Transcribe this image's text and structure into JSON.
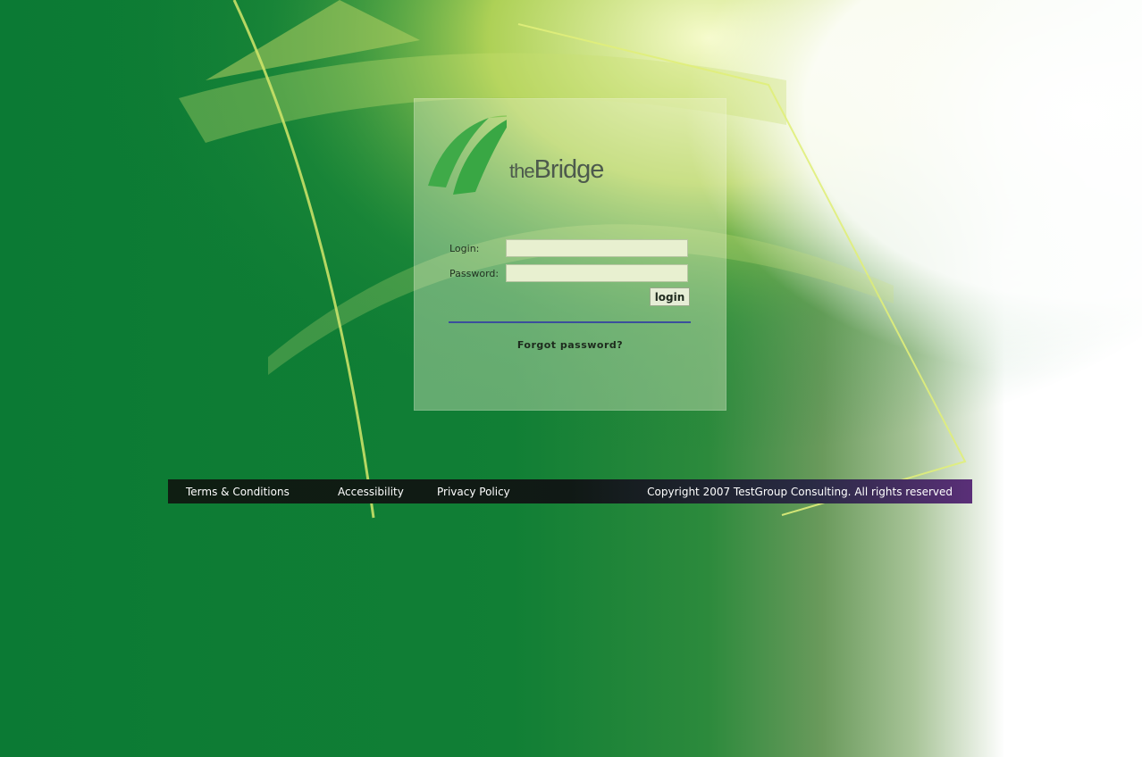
{
  "logo": {
    "text_the": "the",
    "text_bridge": "Bridge"
  },
  "form": {
    "login_label": "Login:",
    "password_label": "Password:",
    "login_value": "",
    "password_value": "",
    "submit_label": "login",
    "forgot_label": "Forgot password?"
  },
  "footer": {
    "links": [
      "Terms & Conditions",
      "Accessibility",
      "Privacy Policy"
    ],
    "copyright": "Copyright 2007 TestGroup Consulting. All rights reserved"
  },
  "colors": {
    "background_green": "#0b7a34",
    "accent_yellow_green": "#d2e66a",
    "divider_blue": "#3b4f9c",
    "footer_purple": "#5a2f78"
  }
}
